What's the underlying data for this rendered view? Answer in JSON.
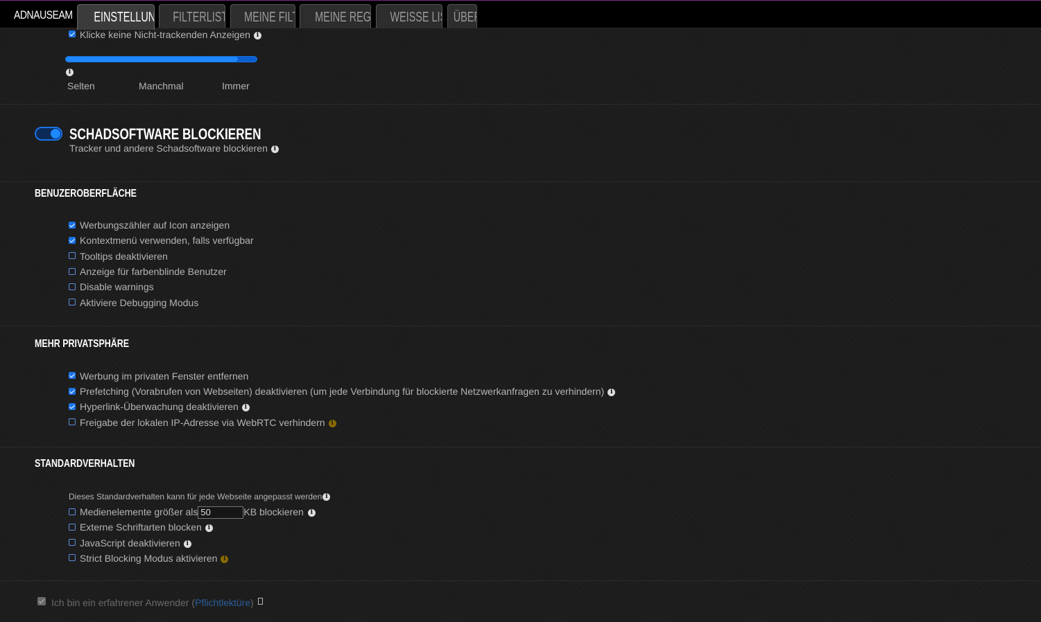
{
  "topbar": {
    "brand": "ADNAUSEAM",
    "tabs": [
      {
        "label": "EINSTELLUNGEN",
        "active": true
      },
      {
        "label": "FILTERLISTEN",
        "active": false
      },
      {
        "label": "MEINE FILTER",
        "active": false
      },
      {
        "label": "MEINE REGELN",
        "active": false
      },
      {
        "label": "WEISSE LISTE",
        "active": false
      },
      {
        "label": "ÜBER",
        "active": false
      }
    ]
  },
  "click_section": {
    "no_nontracking": {
      "label": "Klicke keine Nicht-trackenden Anzeigen",
      "checked": true
    },
    "slider": {
      "labels": [
        "Selten",
        "Manchmal",
        "Immer"
      ],
      "value_fraction": 0.9
    }
  },
  "malware": {
    "title": "SCHADSOFTWARE BLOCKIEREN",
    "subtitle": "Tracker und andere Schadsoftware blockieren",
    "enabled": true
  },
  "ui_section": {
    "title": "BENUZEROBERFLÄCHE",
    "options": [
      {
        "label": "Werbungszähler auf Icon anzeigen",
        "checked": true
      },
      {
        "label": "Kontextmenü verwenden, falls verfügbar",
        "checked": true
      },
      {
        "label": "Tooltips deaktivieren",
        "checked": false
      },
      {
        "label": "Anzeige für farbenblinde Benutzer",
        "checked": false
      },
      {
        "label": "Disable warnings",
        "checked": false
      },
      {
        "label": "Aktiviere Debugging Modus",
        "checked": false
      }
    ]
  },
  "privacy_section": {
    "title": "MEHR PRIVATSPHÄRE",
    "options": [
      {
        "label": "Werbung im privaten Fenster entfernen",
        "checked": true
      },
      {
        "label": "Prefetching (Vorabrufen von Webseiten) deaktivieren (um jede Verbindung für blockierte Netzwerkanfragen zu verhindern)",
        "checked": true
      },
      {
        "label": "Hyperlink-Überwachung deaktivieren",
        "checked": true
      },
      {
        "label": "Freigabe der lokalen IP-Adresse via WebRTC verhindern",
        "checked": false
      }
    ]
  },
  "default_section": {
    "title": "STANDARDVERHALTEN",
    "note": "Dieses Standardverhalten kann für jede Webseite angepasst werden",
    "media_prefix": "Medienelemente größer als",
    "media_value": "50",
    "media_suffix": "KB blockieren",
    "options": [
      {
        "label": "Externe Schriftarten blocken",
        "checked": false
      },
      {
        "label": "JavaScript deaktivieren",
        "checked": false
      },
      {
        "label": "Strict Blocking Modus aktivieren",
        "checked": false
      }
    ]
  },
  "advanced": {
    "label": "Ich bin ein erfahrener Anwender (",
    "link": "Pflichtlektüre",
    "label_end": ")",
    "checked": true
  },
  "colors": {
    "accent": "#1a73e8",
    "background": "#1e1e1e",
    "topbar": "#000000",
    "warn_icon": "#8a6a00"
  }
}
